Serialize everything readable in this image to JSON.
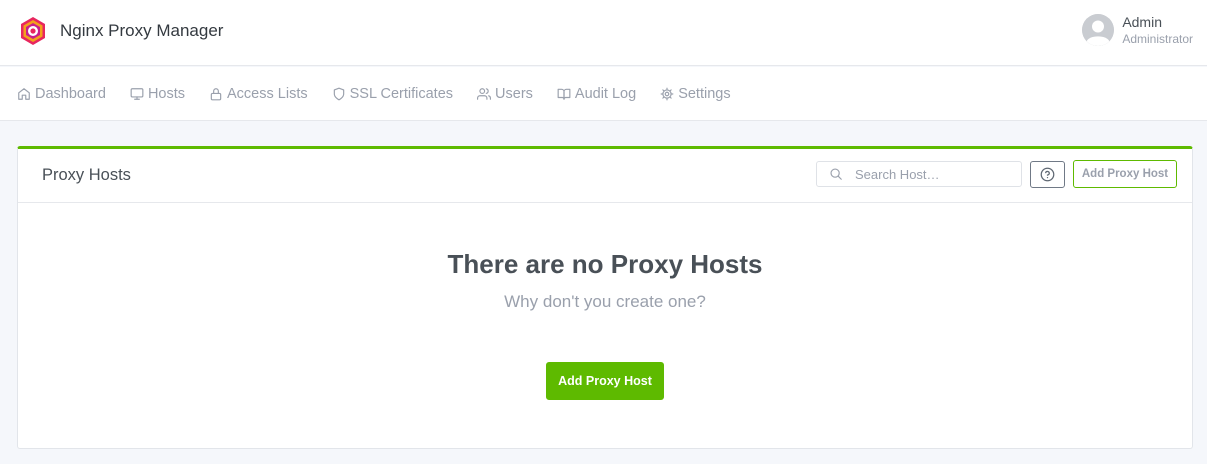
{
  "app": {
    "title": "Nginx Proxy Manager",
    "brand_colors": {
      "accent": "#5eba00",
      "logo_outer": "#e8265e",
      "logo_ring": "#f3a11c"
    }
  },
  "user": {
    "name": "Admin",
    "role": "Administrator"
  },
  "nav": {
    "items": [
      {
        "label": "Dashboard",
        "icon": "home-icon"
      },
      {
        "label": "Hosts",
        "icon": "monitor-icon"
      },
      {
        "label": "Access Lists",
        "icon": "lock-icon"
      },
      {
        "label": "SSL Certificates",
        "icon": "shield-icon"
      },
      {
        "label": "Users",
        "icon": "users-icon"
      },
      {
        "label": "Audit Log",
        "icon": "book-icon"
      },
      {
        "label": "Settings",
        "icon": "gear-icon"
      }
    ]
  },
  "card": {
    "title": "Proxy Hosts",
    "search_placeholder": "Search Host…",
    "add_button_label": "Add Proxy Host",
    "empty_title": "There are no Proxy Hosts",
    "empty_subtitle": "Why don't you create one?",
    "empty_button_label": "Add Proxy Host"
  }
}
